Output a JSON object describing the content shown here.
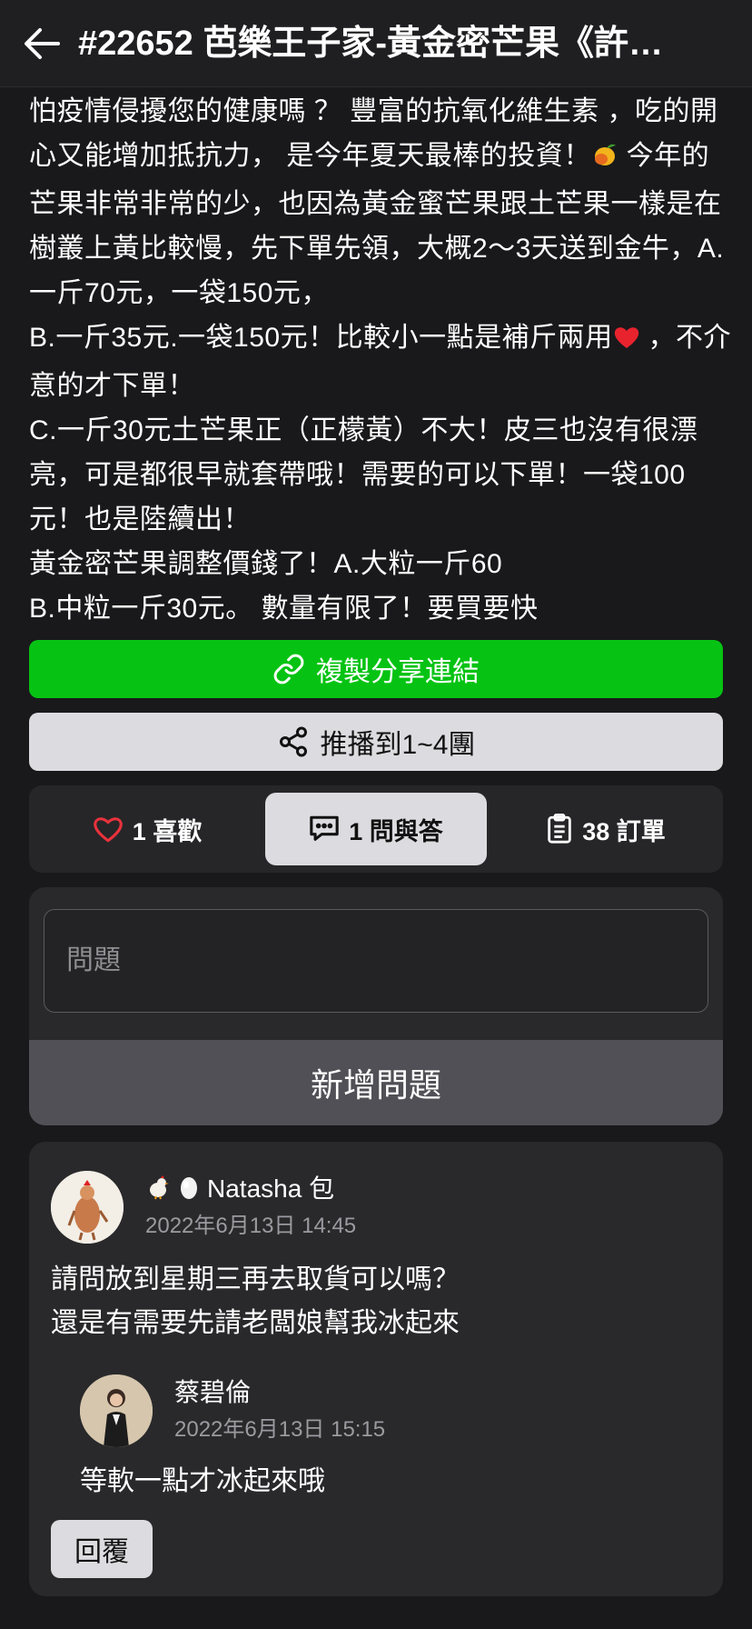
{
  "header": {
    "title": "#22652 芭樂王子家-黃金密芒果《許…",
    "back_icon": "arrow-left-icon"
  },
  "description": {
    "paragraphs": [
      {
        "before": "怕疫情侵擾您的健康嗎 ？ 豐富的抗氧化維生素 ，吃的開心又能增加抵抗力， 是今年夏天最棒的投資！",
        "after": " 今年的芒果非常非常的少，也因為黃金蜜芒果跟土芒果一樣是在樹叢上黃比較慢，先下單先領，大概2～3天送到金牛，A.一斤70元，一袋150元，"
      },
      {
        "before": "B.一斤35元.一袋150元！比較小一點是補斤兩用",
        "after": " ，不介意的才下單！"
      },
      {
        "text": "C.一斤30元土芒果正（正檬黃）不大！皮三也沒有很漂亮，可是都很早就套帶哦！需要的可以下單！一袋100元！也是陸續出！"
      },
      {
        "text": "黃金密芒果調整價錢了！A.大粒一斤60"
      },
      {
        "text": "B.中粒一斤30元。 數量有限了！要買要快"
      }
    ]
  },
  "actions": {
    "copy_label": "複製分享連結",
    "copy_icon": "link-icon",
    "push_label": "推播到1~4團",
    "push_icon": "share-icon",
    "copy_color": "#06c313"
  },
  "tabs": {
    "likes": "1 喜歡",
    "qa": "1 問與答",
    "orders": "38 訂單"
  },
  "question_form": {
    "placeholder": "問題",
    "submit_label": "新增問題"
  },
  "qa": {
    "question": {
      "name": "Natasha 包",
      "time": "2022年6月13日 14:45",
      "lines": [
        "請問放到星期三再去取貨可以嗎？",
        "還是有需要先請老闆娘幫我冰起來"
      ]
    },
    "reply": {
      "name": "蔡碧倫",
      "time": "2022年6月13日 15:15",
      "text": "等軟一點才冰起來哦"
    },
    "reply_button": "回覆"
  }
}
